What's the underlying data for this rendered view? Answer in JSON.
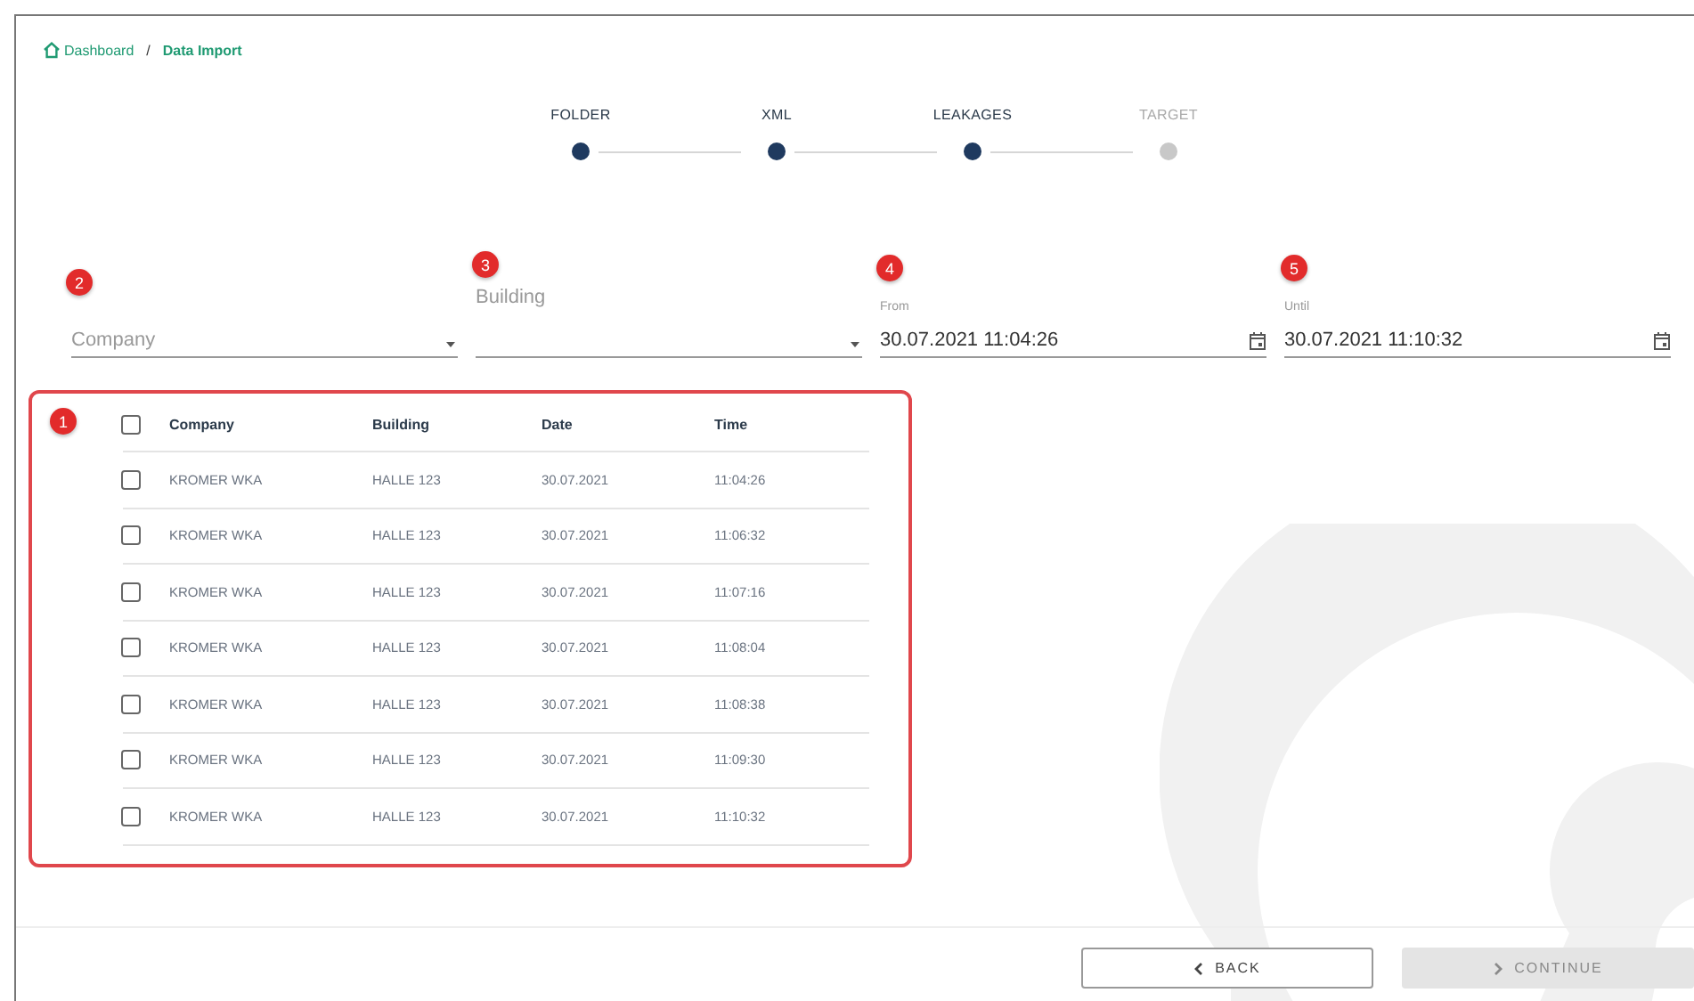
{
  "breadcrumb": [
    {
      "label": "Dashboard",
      "kind": "home"
    },
    {
      "label": "/",
      "kind": "separator"
    },
    {
      "label": "Data Import",
      "kind": "current"
    }
  ],
  "steps": [
    {
      "label": "FOLDER",
      "done": true
    },
    {
      "label": "XML",
      "done": true
    },
    {
      "label": "LEAKAGES",
      "done": true
    },
    {
      "label": "TARGET",
      "done": false
    }
  ],
  "filters": [
    {
      "callout": "2",
      "kind": "select",
      "placeholder": "Company"
    },
    {
      "callout": "3",
      "kind": "select",
      "label": "Building"
    },
    {
      "callout": "4",
      "kind": "date",
      "label": "From",
      "value": "30.07.2021 11:04:26"
    },
    {
      "callout": "5",
      "kind": "date",
      "label": "Until",
      "value": "30.07.2021 11:10:32"
    }
  ],
  "table": {
    "callout": "1",
    "select_all_checked": false,
    "columns": [
      "Company",
      "Building",
      "Date",
      "Time"
    ],
    "rows": [
      {
        "checked": false,
        "cells": [
          "KROMER WKA",
          "HALLE 123",
          "30.07.2021",
          "11:04:26"
        ]
      },
      {
        "checked": false,
        "cells": [
          "KROMER WKA",
          "HALLE 123",
          "30.07.2021",
          "11:06:32"
        ]
      },
      {
        "checked": false,
        "cells": [
          "KROMER WKA",
          "HALLE 123",
          "30.07.2021",
          "11:07:16"
        ]
      },
      {
        "checked": false,
        "cells": [
          "KROMER WKA",
          "HALLE 123",
          "30.07.2021",
          "11:08:04"
        ]
      },
      {
        "checked": false,
        "cells": [
          "KROMER WKA",
          "HALLE 123",
          "30.07.2021",
          "11:08:38"
        ]
      },
      {
        "checked": false,
        "cells": [
          "KROMER WKA",
          "HALLE 123",
          "30.07.2021",
          "11:09:30"
        ]
      },
      {
        "checked": false,
        "cells": [
          "KROMER WKA",
          "HALLE 123",
          "30.07.2021",
          "11:10:32"
        ]
      }
    ]
  },
  "buttons": [
    {
      "label": "BACK",
      "kind": "back",
      "disabled": false
    },
    {
      "label": "CONTINUE",
      "kind": "continue",
      "disabled": true
    }
  ]
}
